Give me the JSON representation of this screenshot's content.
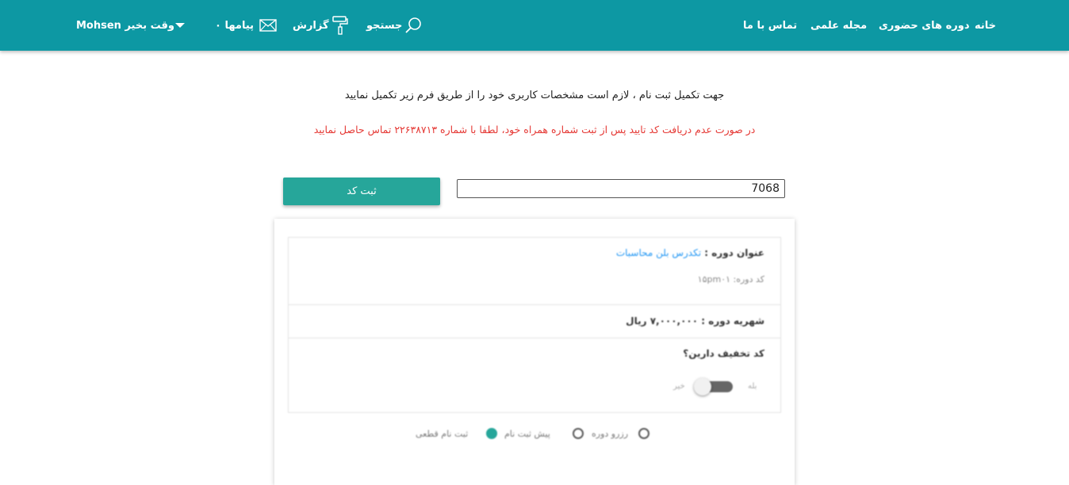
{
  "nav": {
    "home": "خانه",
    "courses": "دوره های حضوری",
    "journal": "مجله علمی",
    "contact": "تماس با ما",
    "search": "جستجو",
    "report": "گزارش",
    "messages": "پیامها ۰",
    "greeting": "Mohsen وقت بخیر",
    "brand_color": "#0d98a3"
  },
  "registration": {
    "intro_text": "جهت تکمیل ثبت نام ، لازم است مشخصات کاربری خود را از طریق فرم زیر تکمیل نمایید",
    "warning_text": "در صورت عدم دریافت کد تایید پس از ثبت شماره همراه خود، لطفا با شماره ۲۲۶۳۸۷۱۳ تماس حاصل نمایید",
    "warning_color": "#e53935",
    "code_value": "7068",
    "submit_label": "ثبت کد",
    "button_color": "#26a69a"
  },
  "course": {
    "title_label": "عنوان دوره :",
    "title_value": "تکدرس بلن محاسبات",
    "code_line": "کد دوره: ۱۵pm۰۱",
    "fee_line": "شهریه دوره : ۷,۰۰۰,۰۰۰ ریال",
    "discount_question": "کد تخفیف دارین؟",
    "toggle_yes": "بله",
    "toggle_no": "خیر",
    "steps": [
      "رزرو دوره",
      "پیش ثبت نام",
      "ثبت نام قطعی"
    ],
    "active_step": "پیش ثبت نام"
  }
}
